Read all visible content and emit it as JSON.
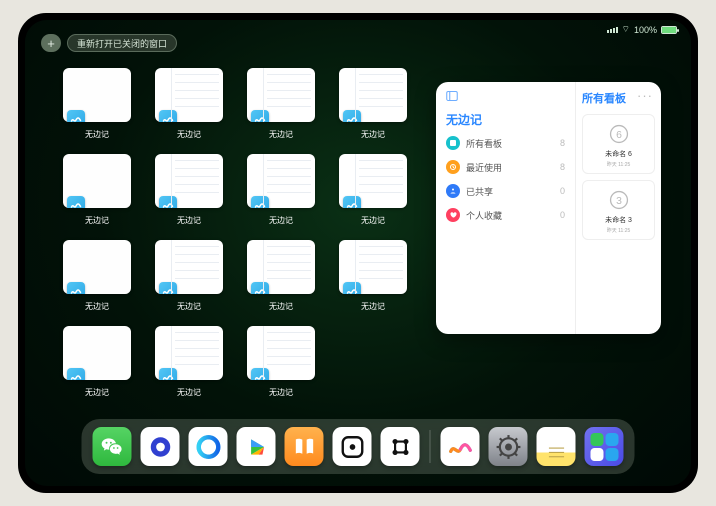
{
  "status": {
    "battery_pct": "100%"
  },
  "toolbar": {
    "add": "+",
    "reopen": "重新打开已关闭的窗口"
  },
  "thumbs": {
    "label": "无边记",
    "items": [
      {
        "style": "blank"
      },
      {
        "style": "cal"
      },
      {
        "style": "cal"
      },
      {
        "style": "cal"
      },
      {
        "style": "blank"
      },
      {
        "style": "cal"
      },
      {
        "style": "cal"
      },
      {
        "style": "cal"
      },
      {
        "style": "blank"
      },
      {
        "style": "cal"
      },
      {
        "style": "cal"
      },
      {
        "style": "cal"
      },
      {
        "style": "blank"
      },
      {
        "style": "cal"
      },
      {
        "style": "cal"
      }
    ]
  },
  "floating": {
    "title": "无边记",
    "right_title": "所有看板",
    "menu": [
      {
        "label": "所有看板",
        "count": "8",
        "color": "d-cyan"
      },
      {
        "label": "最近使用",
        "count": "8",
        "color": "d-orange"
      },
      {
        "label": "已共享",
        "count": "0",
        "color": "d-blue"
      },
      {
        "label": "个人收藏",
        "count": "0",
        "color": "d-red"
      }
    ],
    "boards": [
      {
        "name": "未命名 6",
        "time": "昨天 11:25",
        "glyph": "6"
      },
      {
        "name": "未命名 3",
        "time": "昨天 11:25",
        "glyph": "3"
      }
    ]
  },
  "dock": {
    "apps": [
      {
        "name": "wechat"
      },
      {
        "name": "quark"
      },
      {
        "name": "qq-browser"
      },
      {
        "name": "video"
      },
      {
        "name": "books"
      },
      {
        "name": "dice"
      },
      {
        "name": "grid-game"
      }
    ],
    "recent": [
      {
        "name": "freeform"
      },
      {
        "name": "settings"
      },
      {
        "name": "notes"
      },
      {
        "name": "app-library"
      }
    ]
  }
}
